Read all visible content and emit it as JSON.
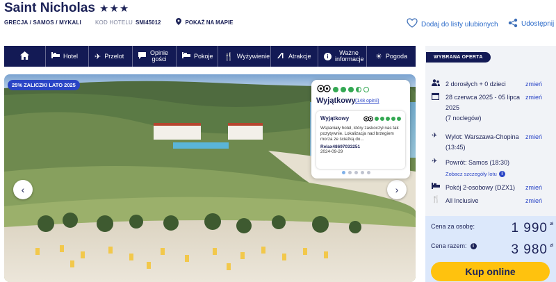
{
  "header": {
    "title": "Saint Nicholas",
    "stars": "★★★",
    "location": "GRECJA / SAMOS / MYKALI",
    "code_label": "KOD HOTELU",
    "code_value": "SMI45012",
    "map_link": "POKAŻ NA MAPIE",
    "favorite_label": "Dodaj do listy ulubionych",
    "share_label": "Udostępnij"
  },
  "nav": {
    "items": [
      {
        "label": "Hotel",
        "icon": "bed-icon"
      },
      {
        "label": "Przelot",
        "icon": "plane-icon"
      },
      {
        "label": "Opinie gości",
        "icon": "chat-icon"
      },
      {
        "label": "Pokoje",
        "icon": "bed-icon"
      },
      {
        "label": "Wyżywienie",
        "icon": "cutlery-icon"
      },
      {
        "label": "Atrakcje",
        "icon": "slide-icon"
      },
      {
        "label": "Ważne informacje",
        "icon": "info-icon"
      },
      {
        "label": "Pogoda",
        "icon": "sun-icon"
      }
    ]
  },
  "gallery": {
    "badge": "25% ZALICZKI LATO 2025"
  },
  "review": {
    "rating_dots": 3.5,
    "title": "Wyjątkowy",
    "count": "(148 opinii)",
    "card_title": "Wyjątkowy",
    "card_rating_dots": 5,
    "text": "Wspaniały hotel, który zaskoczył nas tak pozytywnie. Lokalizacja nad brzegiem morza ze ścieżką do...",
    "author": "Relax48697033251",
    "date": "2024-09-29",
    "pages": 5,
    "active_page": 1
  },
  "offer": {
    "chip": "WYBRANA OFERTA",
    "change_label": "zmień",
    "guests": "2 dorosłych + 0 dzieci",
    "dates": "28 czerwca 2025 - 05 lipca 2025",
    "nights": "(7 noclegów)",
    "outbound": "Wylot: Warszawa-Chopina (13:45)",
    "return": "Powrót: Samos (18:30)",
    "flight_details": "Zobacz szczegóły lotu",
    "room": "Pokój 2-osobowy (DZX1)",
    "board": "All Inclusive",
    "price_person_label": "Cena za osobę:",
    "price_person": "1 990",
    "price_total_label": "Cena razem:",
    "price_total": "3 980",
    "currency": "zł",
    "buy_label": "Kup online"
  },
  "colors": {
    "navy": "#131a55",
    "link_blue": "#2a45c6",
    "buy_yellow": "#ffc20e",
    "price_bg": "#dce8fb",
    "ta_green": "#34a853"
  }
}
